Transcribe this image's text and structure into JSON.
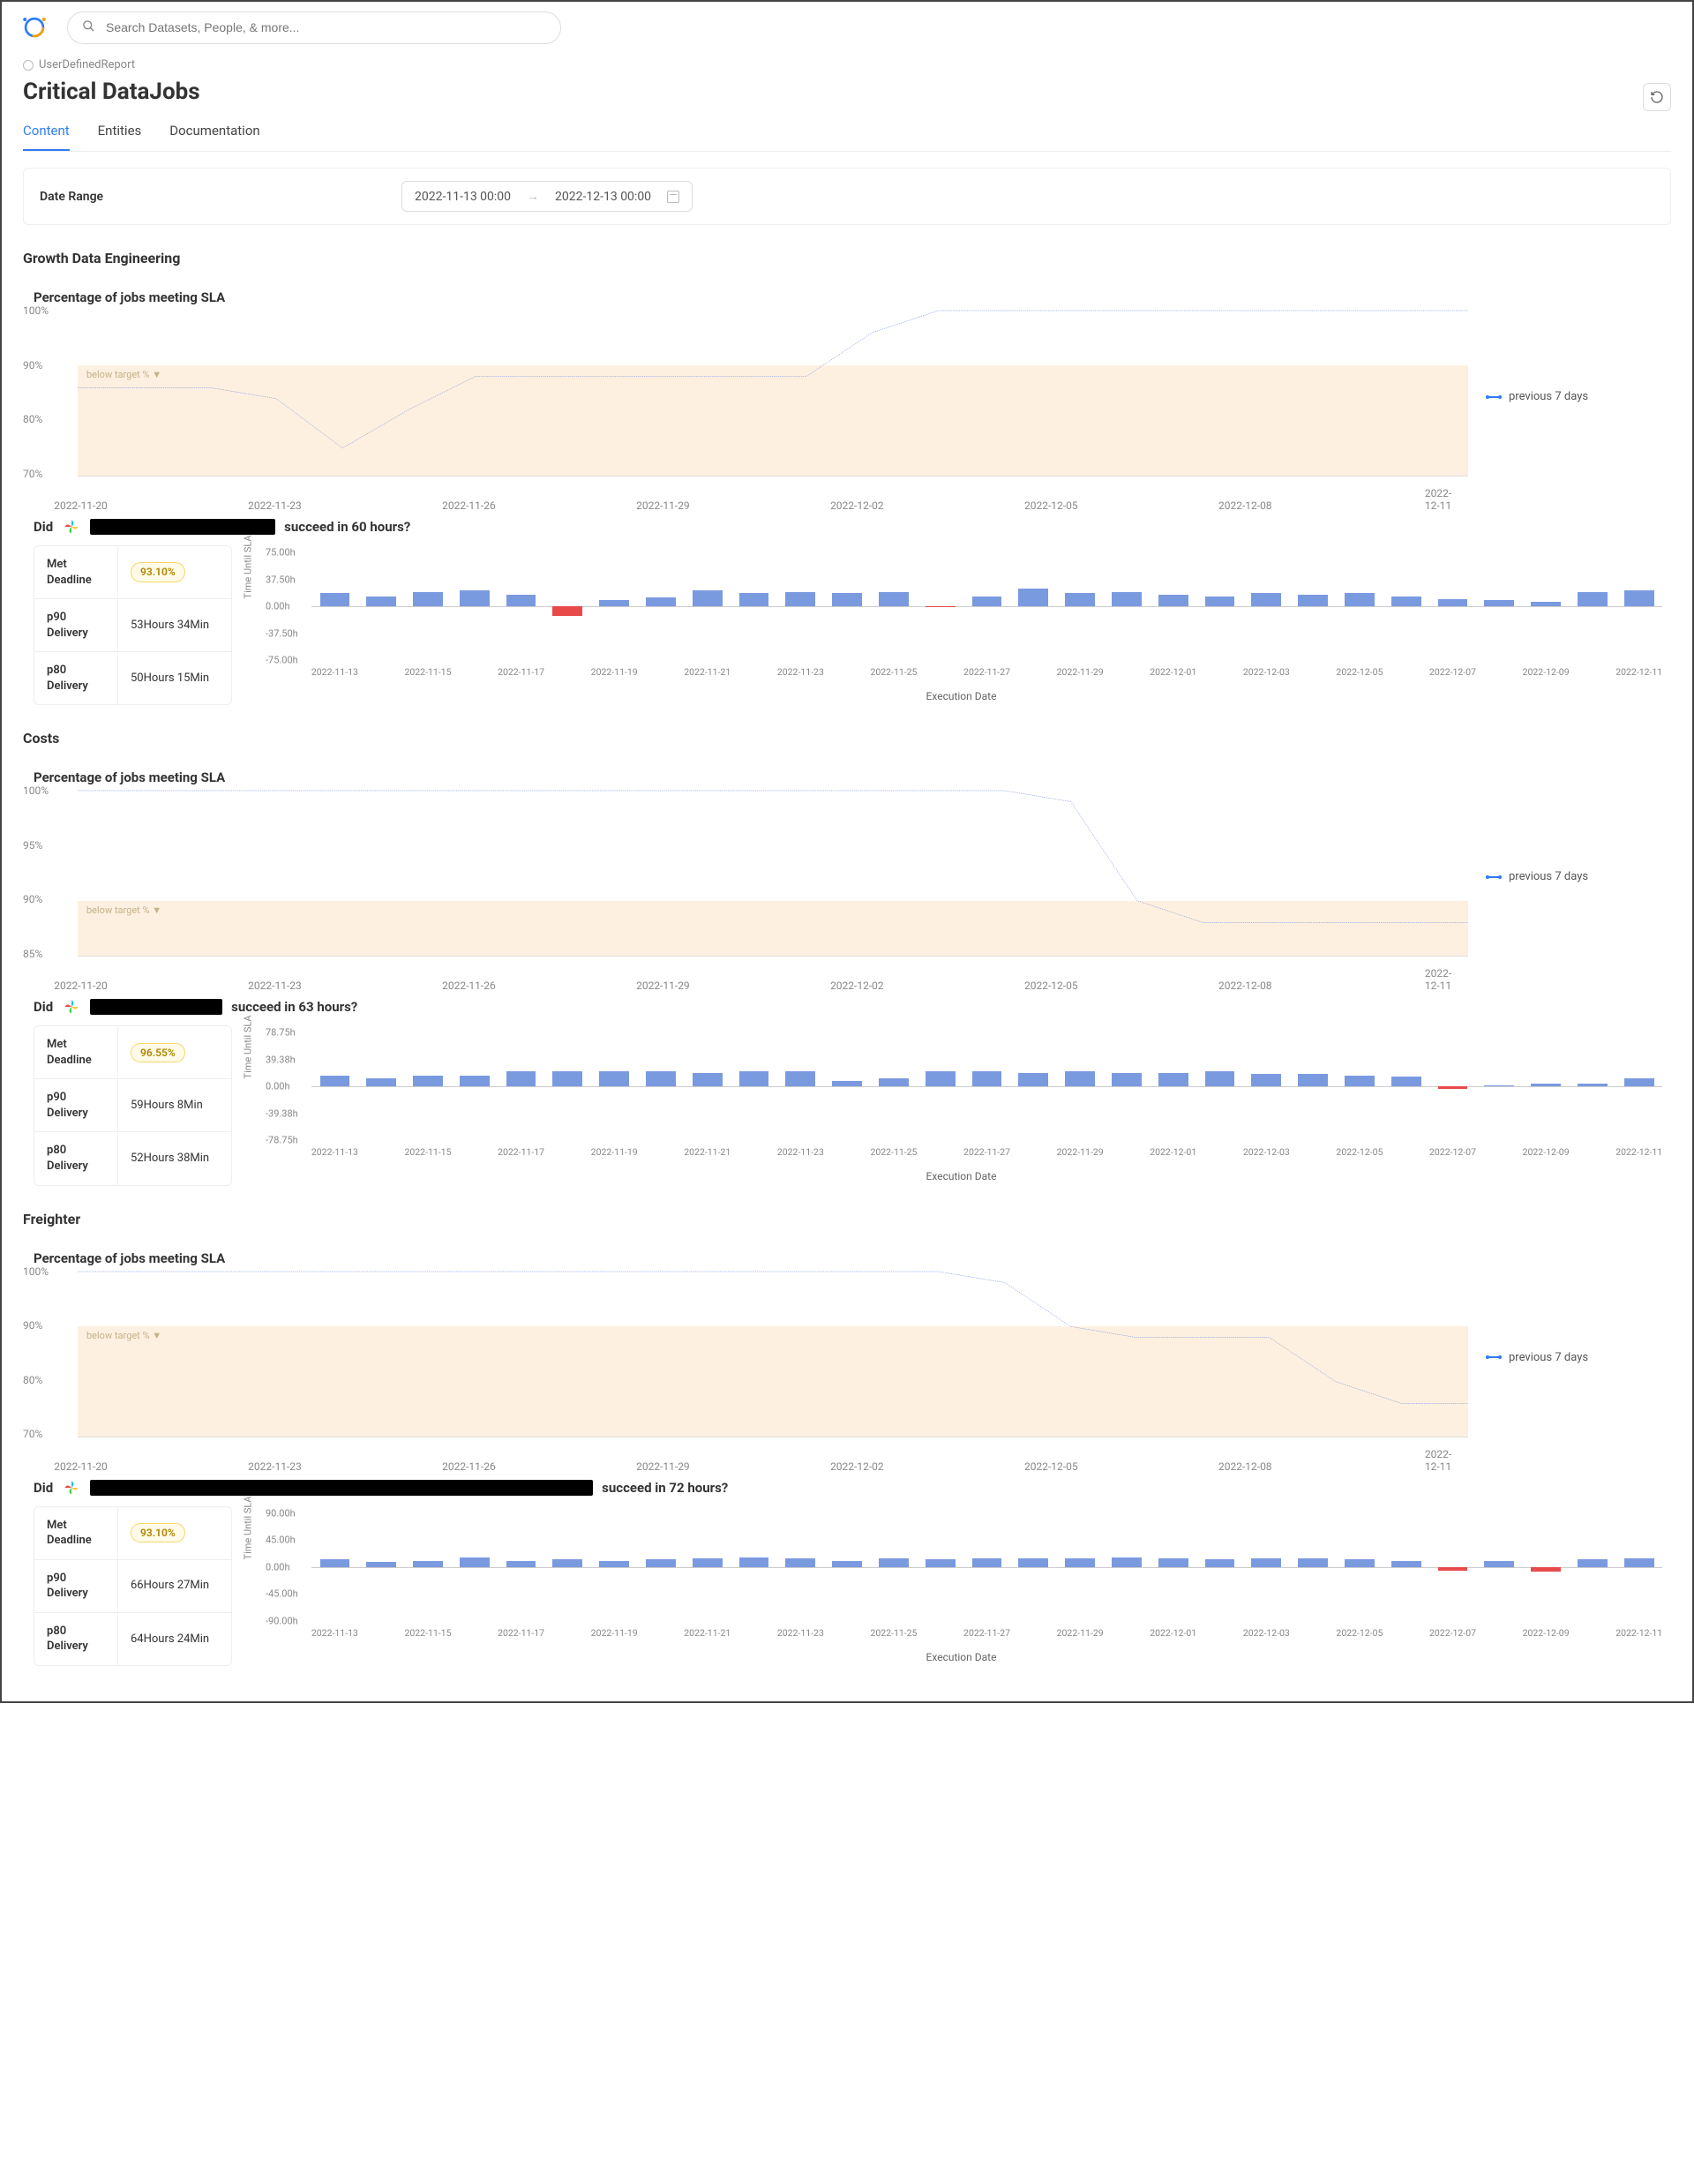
{
  "search": {
    "placeholder": "Search Datasets, People, & more..."
  },
  "breadcrumb": {
    "type": "UserDefinedReport"
  },
  "title": "Critical DataJobs",
  "tabs": [
    {
      "label": "Content",
      "active": true
    },
    {
      "label": "Entities",
      "active": false
    },
    {
      "label": "Documentation",
      "active": false
    }
  ],
  "date_range": {
    "label": "Date Range",
    "start": "2022-11-13 00:00",
    "end": "2022-12-13 00:00"
  },
  "legend_label": "previous 7 days",
  "sla_title": "Percentage of jobs meeting SLA",
  "below_target_label": "below target % ▼",
  "y_axis_bar": "Time Until SLA",
  "x_axis_bar": "Execution Date",
  "sections": [
    {
      "name": "Growth Data Engineering",
      "sla": {
        "y_ticks": [
          "100%",
          "90%",
          "80%",
          "70%"
        ],
        "x_ticks": [
          "2022-11-20",
          "2022-11-23",
          "2022-11-26",
          "2022-11-29",
          "2022-12-02",
          "2022-12-05",
          "2022-12-08",
          "2022-12-11"
        ],
        "shade_from": 90,
        "y_min": 70,
        "y_max": 100
      },
      "job": {
        "prefix": "Did",
        "redact_w": 210,
        "suffix": "succeed in 60 hours?",
        "stats": {
          "met_label": "Met Deadline",
          "met_badge": "93.10%",
          "p90_label": "p90 Delivery",
          "p90_value": "53Hours 34Min",
          "p80_label": "p80 Delivery",
          "p80_value": "50Hours 15Min"
        },
        "bar": {
          "y_ticks": [
            "75.00h",
            "37.50h",
            "0.00h",
            "-37.50h",
            "-75.00h"
          ],
          "y_min": -75,
          "y_max": 75
        }
      }
    },
    {
      "name": "Costs",
      "sla": {
        "y_ticks": [
          "100%",
          "95%",
          "90%",
          "85%"
        ],
        "x_ticks": [
          "2022-11-20",
          "2022-11-23",
          "2022-11-26",
          "2022-11-29",
          "2022-12-02",
          "2022-12-05",
          "2022-12-08",
          "2022-12-11"
        ],
        "shade_from": 90,
        "y_min": 85,
        "y_max": 100
      },
      "job": {
        "prefix": "Did",
        "redact_w": 150,
        "suffix": "succeed in 63 hours?",
        "stats": {
          "met_label": "Met Deadline",
          "met_badge": "96.55%",
          "p90_label": "p90 Delivery",
          "p90_value": "59Hours 8Min",
          "p80_label": "p80 Delivery",
          "p80_value": "52Hours 38Min"
        },
        "bar": {
          "y_ticks": [
            "78.75h",
            "39.38h",
            "0.00h",
            "-39.38h",
            "-78.75h"
          ],
          "y_min": -78.75,
          "y_max": 78.75
        }
      }
    },
    {
      "name": "Freighter",
      "sla": {
        "y_ticks": [
          "100%",
          "90%",
          "80%",
          "70%"
        ],
        "x_ticks": [
          "2022-11-20",
          "2022-11-23",
          "2022-11-26",
          "2022-11-29",
          "2022-12-02",
          "2022-12-05",
          "2022-12-08",
          "2022-12-11"
        ],
        "shade_from": 90,
        "y_min": 70,
        "y_max": 100
      },
      "job": {
        "prefix": "Did",
        "redact_w": 570,
        "suffix": "succeed in 72 hours?",
        "stats": {
          "met_label": "Met Deadline",
          "met_badge": "93.10%",
          "p90_label": "p90 Delivery",
          "p90_value": "66Hours 27Min",
          "p80_label": "p80 Delivery",
          "p80_value": "64Hours 24Min"
        },
        "bar": {
          "y_ticks": [
            "90.00h",
            "45.00h",
            "0.00h",
            "-45.00h",
            "-90.00h"
          ],
          "y_min": -90,
          "y_max": 90
        }
      }
    }
  ],
  "chart_data": [
    {
      "type": "line",
      "title": "Growth Data Engineering — Percentage of jobs meeting SLA",
      "ylabel": "%",
      "ylim": [
        70,
        100
      ],
      "x": [
        "2022-11-20",
        "2022-11-21",
        "2022-11-22",
        "2022-11-23",
        "2022-11-24",
        "2022-11-25",
        "2022-11-26",
        "2022-11-27",
        "2022-11-28",
        "2022-11-29",
        "2022-11-30",
        "2022-12-01",
        "2022-12-02",
        "2022-12-03",
        "2022-12-04",
        "2022-12-05",
        "2022-12-06",
        "2022-12-07",
        "2022-12-08",
        "2022-12-09",
        "2022-12-10",
        "2022-12-11"
      ],
      "series": [
        {
          "name": "previous 7 days",
          "values": [
            86,
            86,
            86,
            84,
            75,
            82,
            88,
            88,
            88,
            88,
            88,
            88,
            96,
            100,
            100,
            100,
            100,
            100,
            100,
            100,
            100,
            100
          ]
        }
      ]
    },
    {
      "type": "bar",
      "title": "Growth Data Engineering — Time Until SLA (60h)",
      "xlabel": "Execution Date",
      "ylabel": "Time Until SLA",
      "ylim": [
        -75,
        75
      ],
      "categories": [
        "2022-11-13",
        "2022-11-14",
        "2022-11-15",
        "2022-11-16",
        "2022-11-17",
        "2022-11-18",
        "2022-11-19",
        "2022-11-20",
        "2022-11-21",
        "2022-11-22",
        "2022-11-23",
        "2022-11-24",
        "2022-11-25",
        "2022-11-26",
        "2022-11-27",
        "2022-11-28",
        "2022-11-29",
        "2022-11-30",
        "2022-12-01",
        "2022-12-02",
        "2022-12-03",
        "2022-12-04",
        "2022-12-05",
        "2022-12-06",
        "2022-12-07",
        "2022-12-08",
        "2022-12-09",
        "2022-12-10",
        "2022-12-11"
      ],
      "values": [
        18,
        14,
        20,
        22,
        16,
        -14,
        8,
        12,
        22,
        18,
        20,
        18,
        20,
        -1,
        14,
        24,
        18,
        20,
        16,
        14,
        18,
        16,
        18,
        14,
        10,
        8,
        6,
        20,
        22
      ]
    },
    {
      "type": "line",
      "title": "Costs — Percentage of jobs meeting SLA",
      "ylabel": "%",
      "ylim": [
        85,
        100
      ],
      "x": [
        "2022-11-20",
        "2022-11-21",
        "2022-11-22",
        "2022-11-23",
        "2022-11-24",
        "2022-11-25",
        "2022-11-26",
        "2022-11-27",
        "2022-11-28",
        "2022-11-29",
        "2022-11-30",
        "2022-12-01",
        "2022-12-02",
        "2022-12-03",
        "2022-12-04",
        "2022-12-05",
        "2022-12-06",
        "2022-12-07",
        "2022-12-08",
        "2022-12-09",
        "2022-12-10",
        "2022-12-11"
      ],
      "series": [
        {
          "name": "previous 7 days",
          "values": [
            100,
            100,
            100,
            100,
            100,
            100,
            100,
            100,
            100,
            100,
            100,
            100,
            100,
            100,
            100,
            99,
            90,
            88,
            88,
            88,
            88,
            88
          ]
        }
      ]
    },
    {
      "type": "bar",
      "title": "Costs — Time Until SLA (63h)",
      "xlabel": "Execution Date",
      "ylabel": "Time Until SLA",
      "ylim": [
        -78.75,
        78.75
      ],
      "categories": [
        "2022-11-13",
        "2022-11-14",
        "2022-11-15",
        "2022-11-16",
        "2022-11-17",
        "2022-11-18",
        "2022-11-19",
        "2022-11-20",
        "2022-11-21",
        "2022-11-22",
        "2022-11-23",
        "2022-11-24",
        "2022-11-25",
        "2022-11-26",
        "2022-11-27",
        "2022-11-28",
        "2022-11-29",
        "2022-11-30",
        "2022-12-01",
        "2022-12-02",
        "2022-12-03",
        "2022-12-04",
        "2022-12-05",
        "2022-12-06",
        "2022-12-07",
        "2022-12-08",
        "2022-12-09",
        "2022-12-10",
        "2022-12-11"
      ],
      "values": [
        16,
        12,
        16,
        16,
        22,
        22,
        22,
        22,
        20,
        22,
        22,
        8,
        12,
        22,
        22,
        20,
        22,
        20,
        20,
        22,
        18,
        18,
        16,
        14,
        -4,
        2,
        4,
        4,
        12
      ]
    },
    {
      "type": "line",
      "title": "Freighter — Percentage of jobs meeting SLA",
      "ylabel": "%",
      "ylim": [
        70,
        100
      ],
      "x": [
        "2022-11-20",
        "2022-11-21",
        "2022-11-22",
        "2022-11-23",
        "2022-11-24",
        "2022-11-25",
        "2022-11-26",
        "2022-11-27",
        "2022-11-28",
        "2022-11-29",
        "2022-11-30",
        "2022-12-01",
        "2022-12-02",
        "2022-12-03",
        "2022-12-04",
        "2022-12-05",
        "2022-12-06",
        "2022-12-07",
        "2022-12-08",
        "2022-12-09",
        "2022-12-10",
        "2022-12-11"
      ],
      "series": [
        {
          "name": "previous 7 days",
          "values": [
            100,
            100,
            100,
            100,
            100,
            100,
            100,
            100,
            100,
            100,
            100,
            100,
            100,
            100,
            98,
            90,
            88,
            88,
            88,
            80,
            76,
            76
          ]
        }
      ]
    },
    {
      "type": "bar",
      "title": "Freighter — Time Until SLA (72h)",
      "xlabel": "Execution Date",
      "ylabel": "Time Until SLA",
      "ylim": [
        -90,
        90
      ],
      "categories": [
        "2022-11-13",
        "2022-11-14",
        "2022-11-15",
        "2022-11-16",
        "2022-11-17",
        "2022-11-18",
        "2022-11-19",
        "2022-11-20",
        "2022-11-21",
        "2022-11-22",
        "2022-11-23",
        "2022-11-24",
        "2022-11-25",
        "2022-11-26",
        "2022-11-27",
        "2022-11-28",
        "2022-11-29",
        "2022-11-30",
        "2022-12-01",
        "2022-12-02",
        "2022-12-03",
        "2022-12-04",
        "2022-12-05",
        "2022-12-06",
        "2022-12-07",
        "2022-12-08",
        "2022-12-09",
        "2022-12-10",
        "2022-12-11"
      ],
      "values": [
        12,
        8,
        10,
        16,
        10,
        12,
        10,
        12,
        14,
        16,
        14,
        10,
        14,
        12,
        14,
        14,
        14,
        16,
        14,
        12,
        14,
        14,
        12,
        10,
        -6,
        10,
        -8,
        12,
        14
      ]
    }
  ]
}
